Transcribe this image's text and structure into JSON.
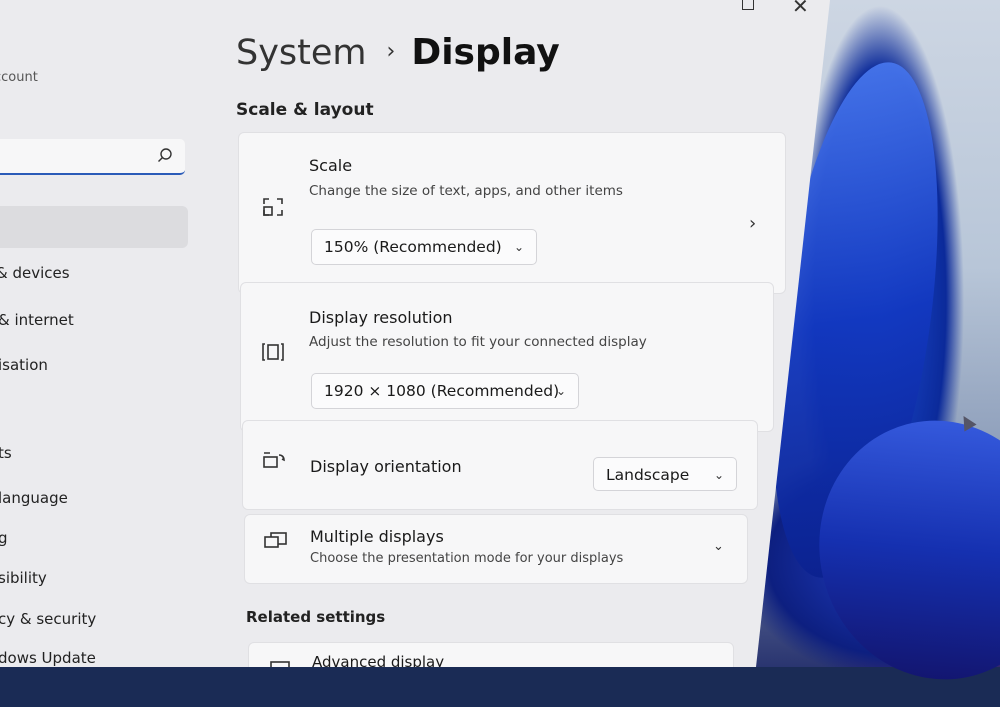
{
  "window": {
    "controls": {
      "maximize": "maximize-icon",
      "close": "✕"
    }
  },
  "sidebar": {
    "account_label": "ccount",
    "search": {
      "placeholder": "",
      "value": ""
    },
    "items": [
      {
        "label": "& devices"
      },
      {
        "label": "& internet"
      },
      {
        "label": "isation"
      },
      {
        "label": "ts"
      },
      {
        "label": "language"
      },
      {
        "label": "g"
      },
      {
        "label": "sibility"
      },
      {
        "label": "cy & security"
      },
      {
        "label": "dows Update"
      }
    ]
  },
  "breadcrumb": {
    "parent": "System",
    "separator": "›",
    "current": "Display"
  },
  "sections": {
    "scale_layout": "Scale & layout",
    "related": "Related settings"
  },
  "scale": {
    "title": "Scale",
    "description": "Change the size of text, apps, and other items",
    "value": "150% (Recommended)",
    "icon": "scale-icon"
  },
  "resolution": {
    "title": "Display resolution",
    "description": "Adjust the resolution to fit your connected display",
    "value": "1920 × 1080 (Recommended)",
    "icon": "resolution-icon"
  },
  "orientation": {
    "title": "Display orientation",
    "value": "Landscape",
    "icon": "orientation-icon"
  },
  "multiple": {
    "title": "Multiple displays",
    "description": "Choose the presentation mode for your displays",
    "icon": "multiple-displays-icon"
  },
  "advanced": {
    "title": "Advanced display"
  },
  "colors": {
    "accent": "#2a5bb8",
    "wallpaper_blue": "#1238c0"
  }
}
